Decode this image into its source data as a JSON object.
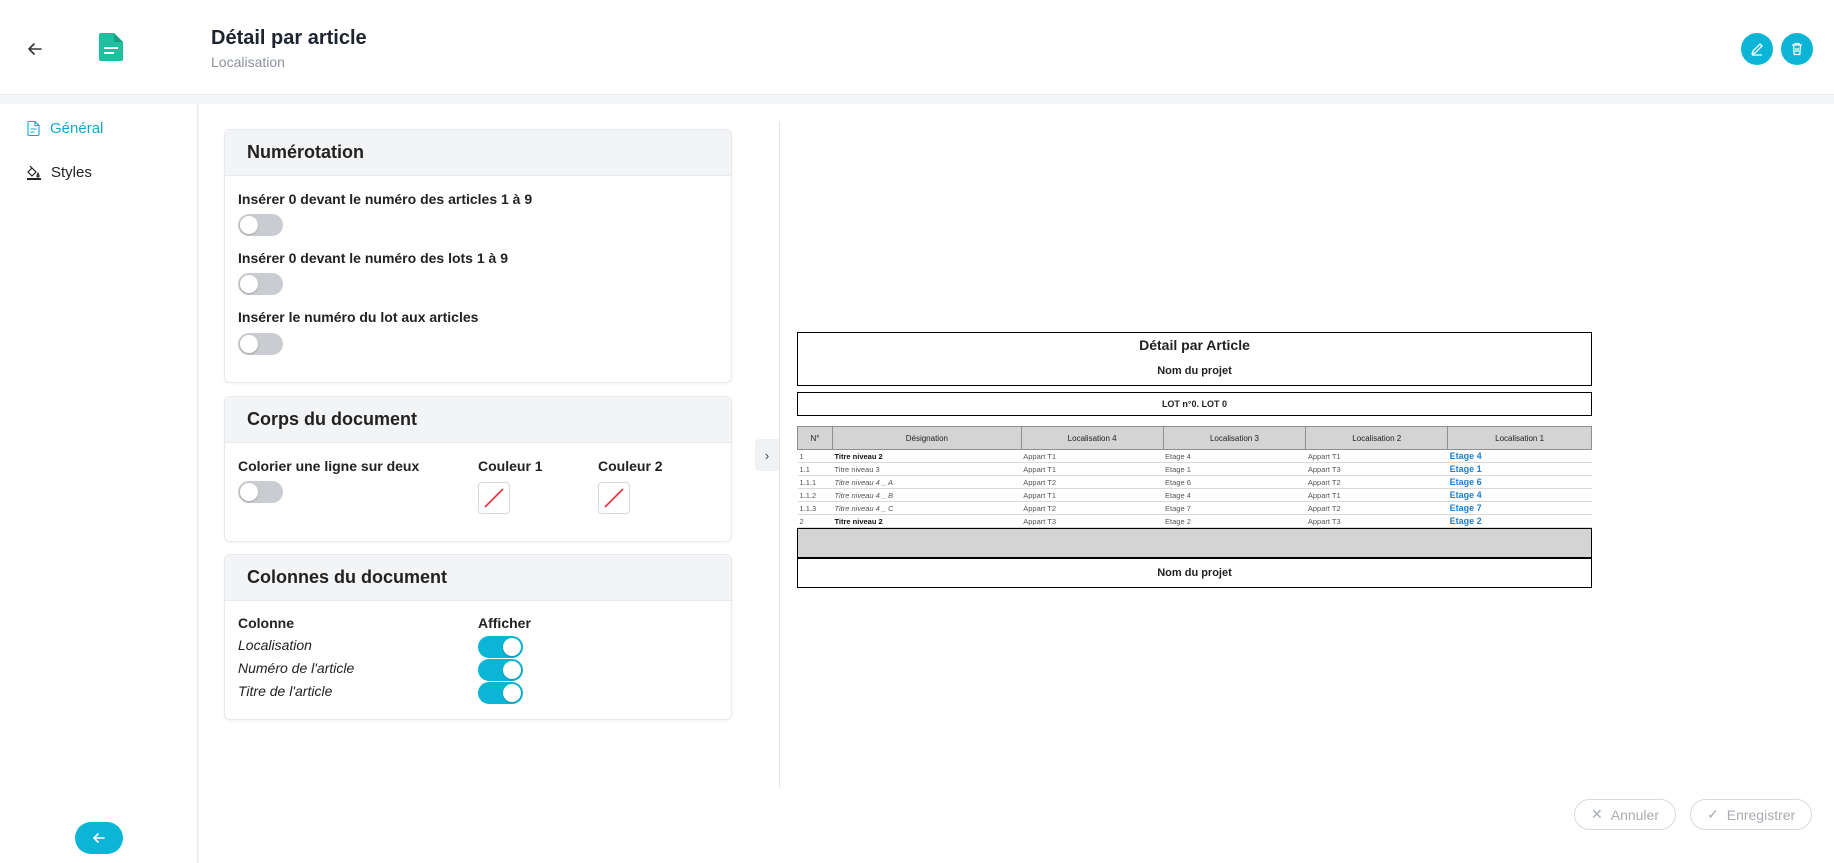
{
  "header": {
    "title": "Détail par article",
    "subtitle": "Localisation"
  },
  "sidebar": {
    "items": [
      {
        "label": "Général",
        "icon": "document-icon",
        "active": true
      },
      {
        "label": "Styles",
        "icon": "paint-bucket-icon",
        "active": false
      }
    ]
  },
  "numerotation": {
    "title": "Numérotation",
    "options": [
      {
        "label": "Insérer 0 devant le numéro des articles 1 à 9",
        "value": false
      },
      {
        "label": "Insérer 0 devant le numéro des lots 1 à 9",
        "value": false
      },
      {
        "label": "Insérer le numéro du lot aux articles",
        "value": false
      }
    ]
  },
  "corps": {
    "title": "Corps du document",
    "alternate_label": "Colorier une ligne sur deux",
    "alternate_value": false,
    "color1_label": "Couleur 1",
    "color2_label": "Couleur 2"
  },
  "colonnes": {
    "title": "Colonnes du document",
    "col_header": "Colonne",
    "show_header": "Afficher",
    "rows": [
      {
        "name": "Localisation",
        "show": true
      },
      {
        "name": "Numéro de l'article",
        "show": true
      },
      {
        "name": "Titre de l'article",
        "show": true
      }
    ]
  },
  "preview": {
    "title": "Détail par Article",
    "project": "Nom du projet",
    "lot": "LOT n°0. LOT 0",
    "headers": [
      "N°",
      "Désignation",
      "Localisation 4",
      "Localisation 3",
      "Localisation 2",
      "Localisation 1"
    ],
    "rows": [
      {
        "num": "1",
        "designation": "Titre niveau 2",
        "style": "bold",
        "loc4": "Appart T1",
        "loc3": "Etage 4",
        "loc2": "Appart T1",
        "loc1": "Etage 4"
      },
      {
        "num": "1.1",
        "designation": "Titre niveau 3",
        "style": "normal",
        "loc4": "Appart T1",
        "loc3": "Etage 1",
        "loc2": "Appart T3",
        "loc1": "Etage 1"
      },
      {
        "num": "1.1.1",
        "designation": "Titre niveau 4 _ A",
        "style": "italic",
        "loc4": "Appart T2",
        "loc3": "Etage 6",
        "loc2": "Appart T2",
        "loc1": "Etage 6"
      },
      {
        "num": "1.1.2",
        "designation": "Titre niveau 4 _ B",
        "style": "italic",
        "loc4": "Appart T1",
        "loc3": "Etage 4",
        "loc2": "Appart T1",
        "loc1": "Etage 4"
      },
      {
        "num": "1.1.3",
        "designation": "Titre niveau 4 _ C",
        "style": "italic",
        "loc4": "Appart T2",
        "loc3": "Etage 7",
        "loc2": "Appart T2",
        "loc1": "Etage 7"
      },
      {
        "num": "2",
        "designation": "Titre niveau 2",
        "style": "bold",
        "loc4": "Appart T3",
        "loc3": "Etage 2",
        "loc2": "Appart T3",
        "loc1": "Etage 2"
      }
    ]
  },
  "footer": {
    "cancel_label": "Annuler",
    "save_label": "Enregistrer"
  },
  "colors": {
    "accent": "#0bb5d6",
    "brand_icon": "#1fbf9f",
    "link": "#1e7fcc"
  }
}
